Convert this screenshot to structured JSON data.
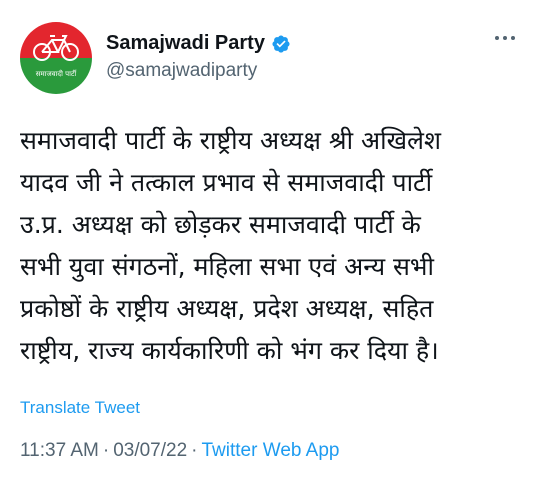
{
  "author": {
    "display_name": "Samajwadi Party",
    "handle": "@samajwadiparty",
    "verified": true,
    "avatar_text": "समाजवादी पार्टी",
    "colors": {
      "red": "#e3262e",
      "green": "#2a9a3c",
      "white": "#ffffff"
    }
  },
  "more_icon": "ellipsis-icon",
  "tweet": {
    "lines": [
      "समाजवादी पार्टी के राष्ट्रीय अध्यक्ष श्री अखिलेश",
      "यादव जी ने तत्काल प्रभाव से समाजवादी पार्टी",
      "उ.प्र. अध्यक्ष को छोड़कर समाजवादी पार्टी के",
      "सभी युवा संगठनों, महिला सभा एवं अन्य सभी",
      "प्रकोष्ठों के राष्ट्रीय अध्यक्ष, प्रदेश अध्यक्ष, सहित",
      "राष्ट्रीय, राज्य कार्यकारिणी को भंग कर दिया है।"
    ]
  },
  "translate_label": "Translate Tweet",
  "meta": {
    "time": "11:37 AM",
    "sep1": "·",
    "date": "03/07/22",
    "sep2": "·",
    "source": "Twitter Web App"
  },
  "colors": {
    "accent": "#1d9bf0",
    "secondary_text": "#536471",
    "text": "#0f1419"
  }
}
